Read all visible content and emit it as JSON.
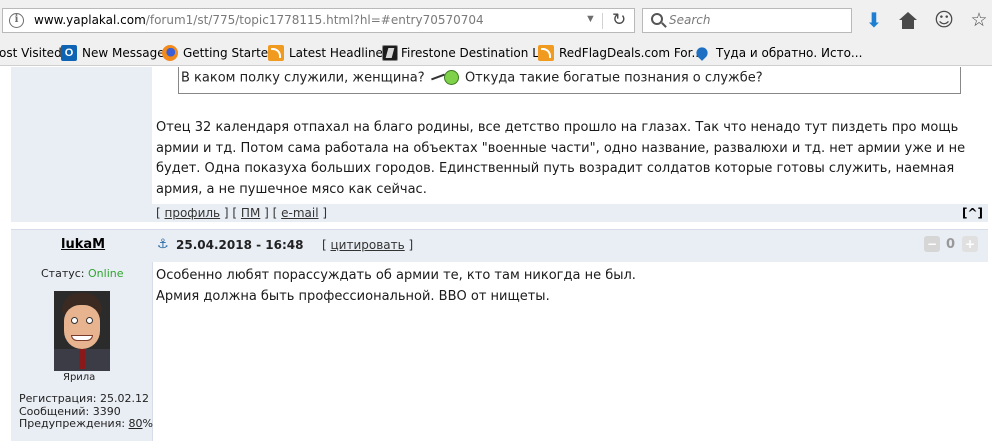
{
  "browser": {
    "url_host": "www.yaplakal.com",
    "url_path": "/forum1/st/775/topic1778115.html?hl=#entry70570704",
    "url_scheme": "",
    "search_placeholder": "Search",
    "reload_glyph": "↻",
    "download_glyph": "⬇",
    "smile_glyph": "☺",
    "star_glyph": "☆",
    "icons": [
      "info-icon",
      "reload-icon",
      "search-icon",
      "download-icon",
      "home-icon",
      "smile-icon",
      "bookmark-star-icon"
    ]
  },
  "bookmarks": [
    {
      "label": "ost Visited",
      "icon": "none"
    },
    {
      "label": "New Message",
      "icon": "outlook-icon"
    },
    {
      "label": "Getting Started",
      "icon": "firefox-icon"
    },
    {
      "label": "Latest Headlines",
      "icon": "rss-icon"
    },
    {
      "label": "Firestone Destination L...",
      "icon": "firestone-icon"
    },
    {
      "label": "RedFlagDeals.com For...",
      "icon": "rss-icon"
    },
    {
      "label": "Туда и обратно. Исто...",
      "icon": "pin-icon"
    }
  ],
  "post1": {
    "quote_line1": "В каком полку служили, женщина?",
    "quote_line2": "Откуда такие богатые познания о службе?",
    "body": [
      "Отец 32 календаря отпахал на благо родины, все детство прошло на глазах. Так что ненадо тут пиздеть про мощь",
      "армии и тд. Потом сама работала на объектах \"военные части\", одно название, развалюхи и тд. нет армии уже и не",
      "будет. Одна показуха больших городов. Единственный путь возрадит солдатов которые готовы служить, наемная",
      "армия, а не пушечное мясо как сейчас."
    ],
    "link_profile": "профиль",
    "link_pm": "ПМ",
    "link_email": "e-mail",
    "top_button": "[^]"
  },
  "post2": {
    "author": "lukaM",
    "date": "25.04.2018 - 16:48",
    "quote_link": "цитировать",
    "vote_count": "0",
    "status_label": "Статус:",
    "status_value": "Online",
    "rank": "Ярила",
    "registration_label": "Регистрация:",
    "registration_value": "25.02.12",
    "messages_label": "Сообщений:",
    "messages_value": "3390",
    "warnings_label": "Предупреждения:",
    "warnings_value": "80",
    "warnings_suffix": "%",
    "body": [
      "Особенно любят порассуждать об армии те, кто там никогда не был.",
      "Армия должна быть профессиональной. ВВО от нищеты."
    ]
  }
}
